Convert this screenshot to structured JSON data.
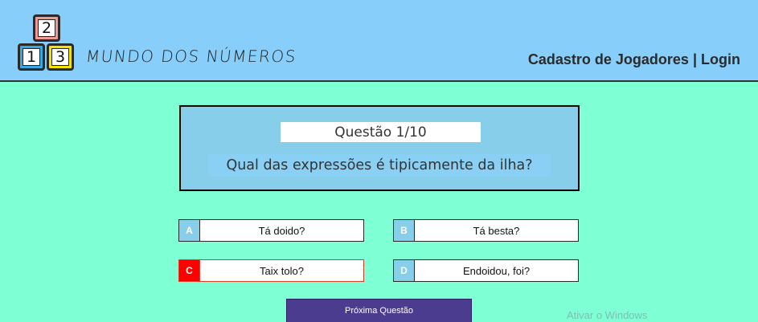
{
  "header": {
    "logo_blocks": [
      "2",
      "1",
      "3"
    ],
    "brand": "MUNDO DOS NÚMEROS",
    "nav_register": "Cadastro de Jogadores",
    "nav_separator": "|",
    "nav_login": "Login"
  },
  "quiz": {
    "counter": "Questão 1/10",
    "question": "Qual das expressões é tipicamente da ilha?",
    "answers": [
      {
        "letter": "A",
        "text": "Tá doido?"
      },
      {
        "letter": "B",
        "text": "Tá besta?"
      },
      {
        "letter": "C",
        "text": "Taix tolo?"
      },
      {
        "letter": "D",
        "text": "Endoidou, foi?"
      }
    ],
    "next_label": "Próxima Questão"
  },
  "watermark": "Ativar o Windows",
  "colors": {
    "page_bg": "#7fffd4",
    "header_bg": "#87cefa",
    "question_bg": "#87ceeb",
    "selected": "#ff0000",
    "button": "#4b3c8f"
  }
}
